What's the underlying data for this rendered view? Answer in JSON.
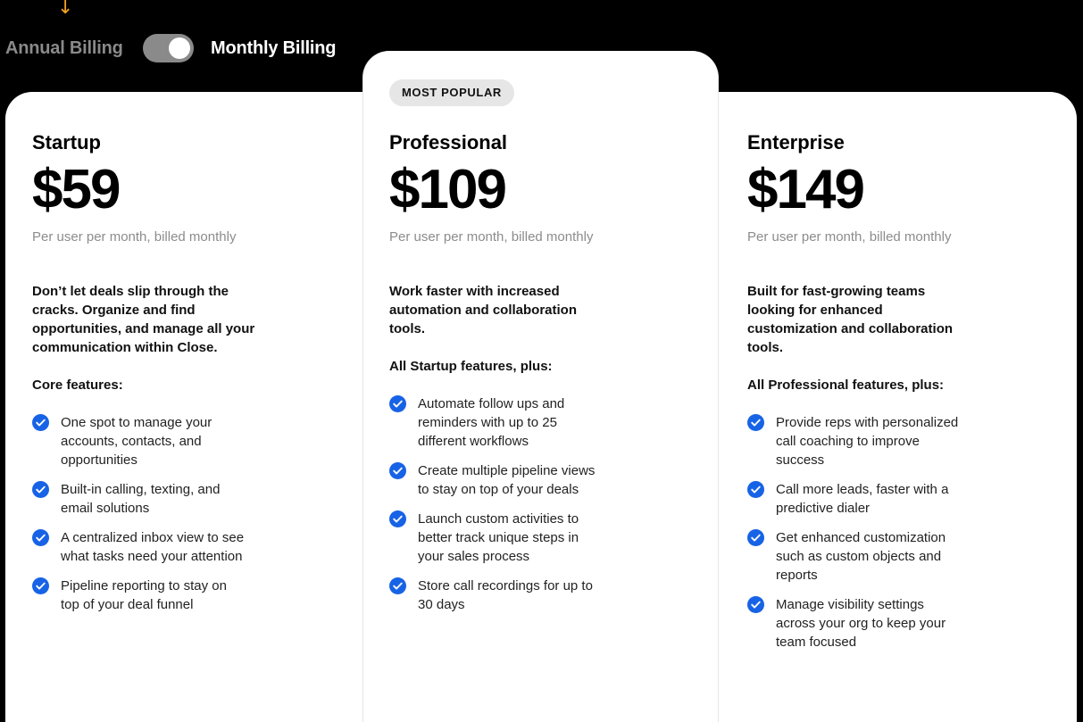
{
  "billing": {
    "annual_label": "Annual Billing",
    "monthly_label": "Monthly Billing",
    "selected": "monthly"
  },
  "colors": {
    "accent": "#1763e6",
    "toggle_bg": "#8a8a8a",
    "badge_bg": "#e6e6e6"
  },
  "icons": {
    "annotation": "arrow-down-icon",
    "feature": "check-circle-icon"
  },
  "plans": [
    {
      "name": "Startup",
      "price": "$59",
      "billing_note": "Per user per month, billed monthly",
      "description": "Don’t let deals slip through the cracks. Organize and find opportunities, and manage all your communication within Close.",
      "features_heading": "Core features:",
      "features": [
        "One spot to manage your accounts, contacts, and opportunities",
        "Built-in calling, texting, and email solutions",
        "A centralized inbox view to see what tasks need your attention",
        "Pipeline reporting to stay on top of your deal funnel"
      ]
    },
    {
      "badge": "MOST POPULAR",
      "name": "Professional",
      "price": "$109",
      "billing_note": "Per user per month, billed monthly",
      "description": "Work faster with increased automation and collaboration tools.",
      "features_heading": "All Startup features, plus:",
      "features": [
        "Automate follow ups and reminders with up to 25 different workflows",
        "Create multiple pipeline views to stay on top of your deals",
        "Launch custom activities to better track unique steps in your sales process",
        "Store call recordings for up to 30 days"
      ]
    },
    {
      "name": "Enterprise",
      "price": "$149",
      "billing_note": "Per user per month, billed monthly",
      "description": "Built for fast-growing teams looking for enhanced customization and collaboration tools.",
      "features_heading": "All Professional features, plus:",
      "features": [
        "Provide reps with personalized call coaching to improve success",
        "Call more leads, faster with a predictive dialer",
        "Get enhanced customization such as custom objects and reports",
        "Manage visibility settings across your org to keep your team focused"
      ]
    }
  ]
}
